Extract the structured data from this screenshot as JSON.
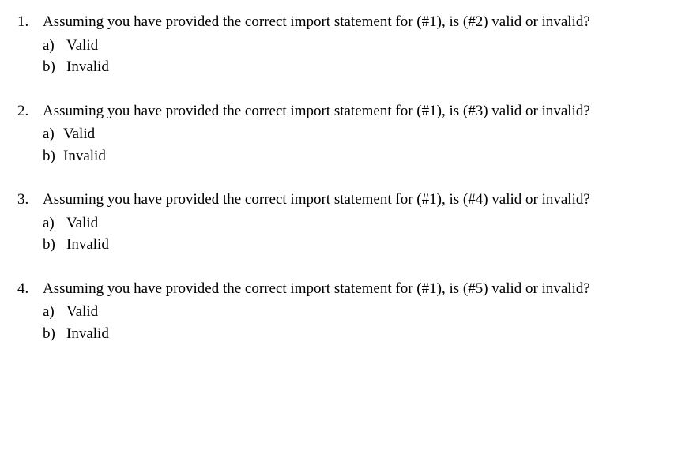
{
  "questions": [
    {
      "number": "1.",
      "text": "Assuming you have provided the correct import statement for (#1), is (#2) valid or invalid?",
      "options": [
        {
          "letter": "a)",
          "text": "Valid"
        },
        {
          "letter": "b)",
          "text": "Invalid"
        }
      ]
    },
    {
      "number": "2.",
      "text": "Assuming you have provided the correct import statement for (#1), is (#3) valid or invalid?",
      "options": [
        {
          "letter": "a)",
          "text": "Valid"
        },
        {
          "letter": "b)",
          "text": "Invalid"
        }
      ]
    },
    {
      "number": "3.",
      "text": "Assuming you have provided the correct import statement for (#1), is (#4) valid or invalid?",
      "options": [
        {
          "letter": "a)",
          "text": "Valid"
        },
        {
          "letter": "b)",
          "text": "Invalid"
        }
      ]
    },
    {
      "number": "4.",
      "text": "Assuming you have provided the correct import statement for (#1), is (#5) valid or invalid?",
      "options": [
        {
          "letter": "a)",
          "text": "Valid"
        },
        {
          "letter": "b)",
          "text": "Invalid"
        }
      ]
    }
  ]
}
